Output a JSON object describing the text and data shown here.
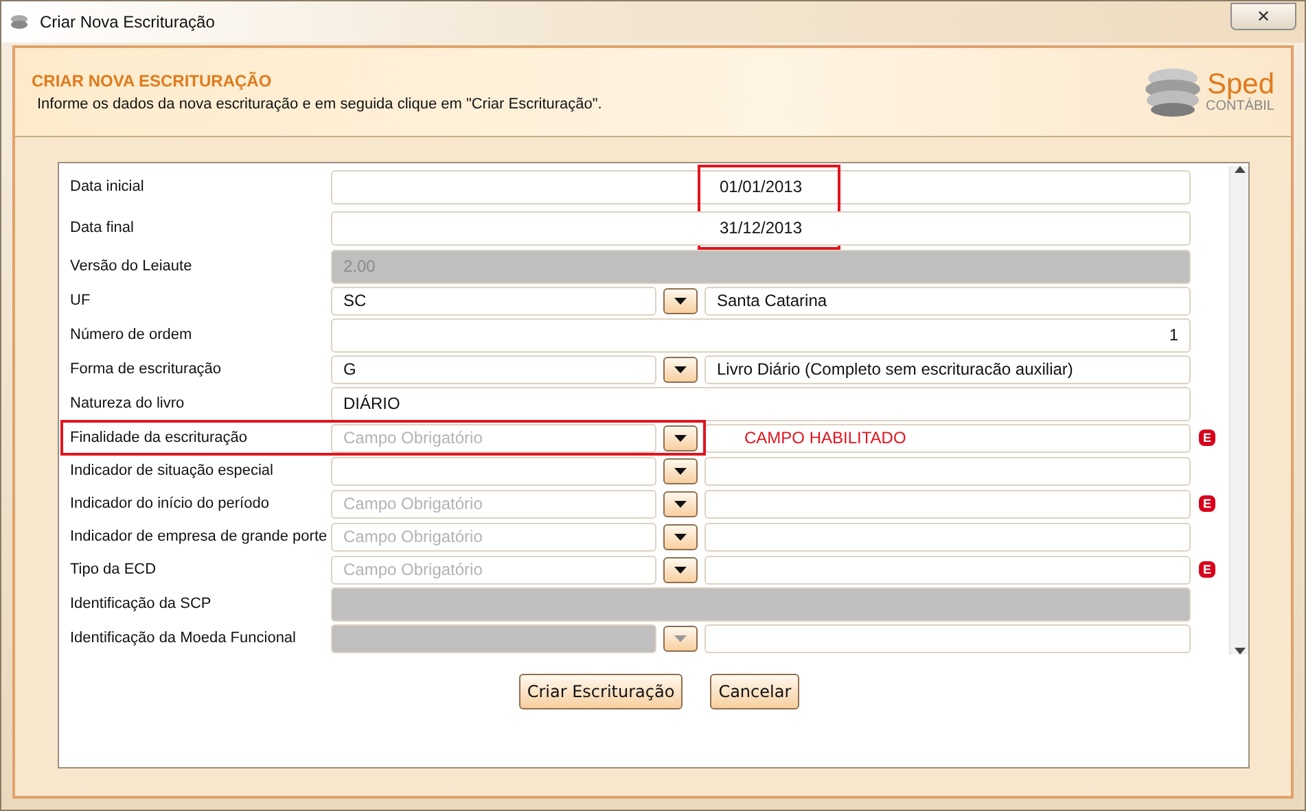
{
  "window": {
    "title": "Criar Nova Escrituração",
    "close": "✕"
  },
  "header": {
    "title": "CRIAR NOVA ESCRITURAÇÃO",
    "subtitle": "Informe os dados da nova escrituração e em seguida clique em \"Criar Escrituração\".",
    "logo_name": "Sped",
    "logo_sub": "CONTÁBIL"
  },
  "fields": [
    {
      "kind": "date",
      "label": "Data inicial",
      "value": "01/01/2013",
      "disabled": false,
      "highlighted": true
    },
    {
      "kind": "date",
      "label": "Data final",
      "value": "31/12/2013",
      "disabled": false,
      "highlighted": true
    },
    {
      "kind": "text",
      "label": "Versão do Leiaute",
      "value": "2.00",
      "disabled": true,
      "highlighted": false
    },
    {
      "kind": "combo",
      "label": "UF",
      "value": "SC",
      "description": "Santa Catarina",
      "disabled": false,
      "highlighted": false
    },
    {
      "kind": "number",
      "label": "Número de ordem",
      "value": "1",
      "disabled": false,
      "highlighted": false
    },
    {
      "kind": "combo",
      "label": "Forma de escrituração",
      "value": "G",
      "description": "Livro Diário (Completo sem escrituracão auxiliar)",
      "disabled": false,
      "highlighted": false
    },
    {
      "kind": "text",
      "label": "Natureza do livro",
      "value": "DIÁRIO",
      "disabled": false,
      "highlighted": false
    },
    {
      "kind": "combo",
      "label": "Finalidade da escrituração",
      "placeholder": "Campo Obrigatório",
      "description": "CAMPO HABILITADO",
      "description_alert": true,
      "error_badge": "E",
      "disabled": false,
      "highlighted": true
    },
    {
      "kind": "combo",
      "label": "Indicador de situação especial",
      "disabled": false,
      "highlighted": false
    },
    {
      "kind": "combo",
      "label": "Indicador do início do período",
      "placeholder": "Campo Obrigatório",
      "error_badge": "E",
      "disabled": false,
      "highlighted": false
    },
    {
      "kind": "combo",
      "label": "Indicador de empresa de grande porte",
      "placeholder": "Campo Obrigatório",
      "disabled": false,
      "highlighted": false
    },
    {
      "kind": "combo",
      "label": "Tipo da ECD",
      "placeholder": "Campo Obrigatório",
      "error_badge": "E",
      "disabled": false,
      "highlighted": false
    },
    {
      "kind": "text",
      "label": "Identificação da SCP",
      "disabled": true,
      "highlighted": false
    },
    {
      "kind": "combo",
      "label": "Identificação da Moeda Funcional",
      "disabled": true,
      "highlighted": false
    }
  ],
  "buttons": [
    "Criar Escrituração",
    "Cancelar"
  ]
}
